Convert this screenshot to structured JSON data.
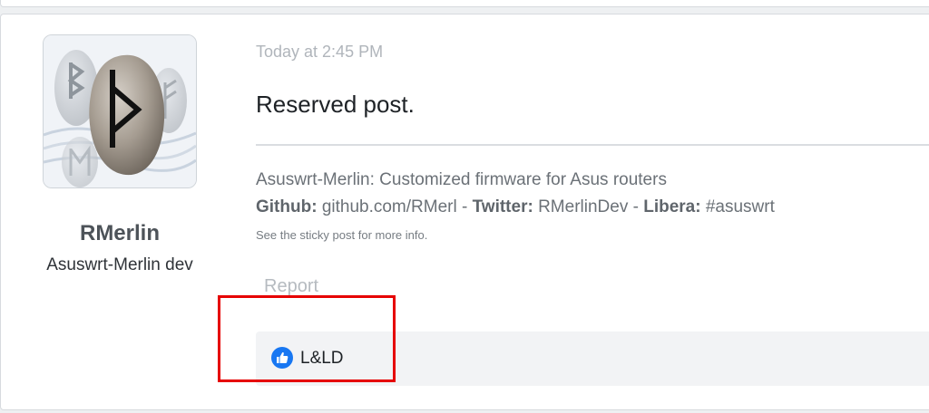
{
  "post": {
    "timestamp": "Today at 2:45 PM",
    "message": "Reserved post.",
    "report_label": "Report"
  },
  "user": {
    "name": "RMerlin",
    "title": "Asuswrt-Merlin dev"
  },
  "signature": {
    "line1": "Asuswrt-Merlin: Customized firmware for Asus routers",
    "github_label": "Github:",
    "github_value": "github.com/RMerl",
    "sep1": " - ",
    "twitter_label": "Twitter:",
    "twitter_value": "RMerlinDev",
    "sep2": " - ",
    "libera_label": "Libera:",
    "libera_value": "#asuswrt",
    "line3": "See the sticky post for more info."
  },
  "reactions": {
    "icon": "thumbs-up-icon",
    "text": "L&LD"
  },
  "colors": {
    "highlight": "#e60000",
    "like_blue": "#1877f2"
  }
}
